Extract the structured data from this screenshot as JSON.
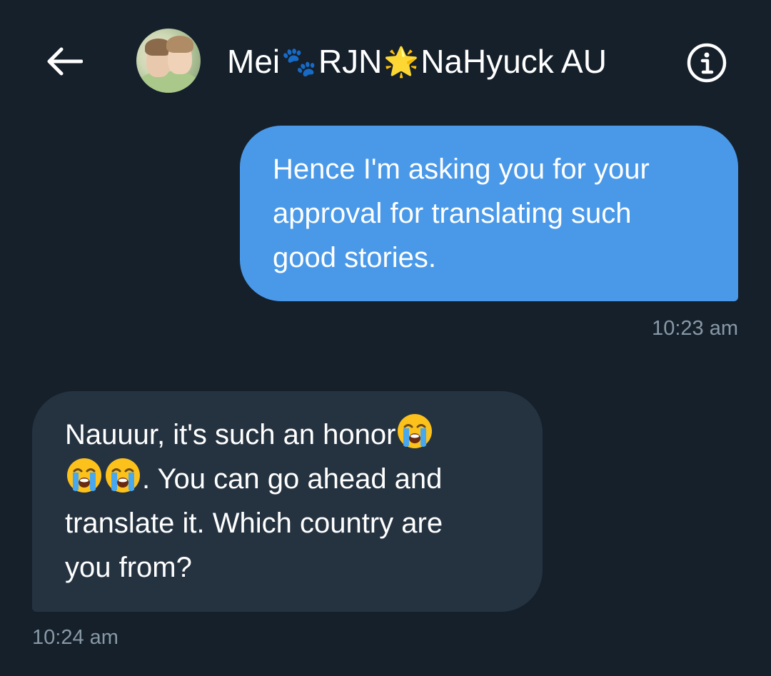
{
  "header": {
    "back_icon": "arrow-left-icon",
    "title_part1": "Mei",
    "title_paw_emoji": "🐾",
    "title_part2": "RJN",
    "title_sun_emoji": "🌟",
    "title_part3": "NaHyuck AU",
    "info_icon": "info-circle-icon"
  },
  "messages": [
    {
      "direction": "sent",
      "lines": [
        "Hence I'm asking you for your",
        "approval for translating such",
        "good stories."
      ],
      "time": "10:23 am",
      "color": "#4a99e9"
    },
    {
      "direction": "received",
      "line1": "Nauuur, it's such an honor",
      "line2_suffix": ". You can go ahead and",
      "line3": "translate it. Which country are",
      "line4": "you from?",
      "emoji": "loudly-crying-face",
      "time": "10:24 am",
      "color": "#253341"
    }
  ],
  "colors": {
    "background": "#15202b",
    "timestamp": "#8899a6"
  }
}
